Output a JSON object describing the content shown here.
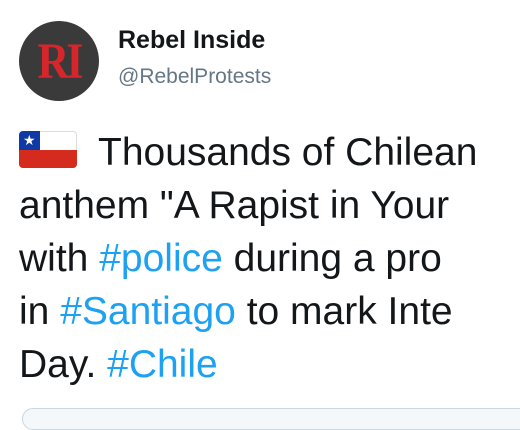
{
  "tweet": {
    "author": {
      "avatar_text": "RI",
      "display_name": "Rebel Inside",
      "handle": "@RebelProtests"
    },
    "flag_emoji": "chile-flag",
    "text_lines": [
      [
        "Thousands of Chilean"
      ],
      [
        "anthem \"A Rapist in Your"
      ],
      [
        "with ",
        "#police",
        " during a pro"
      ],
      [
        "in ",
        "#Santiago",
        " to mark Inte"
      ],
      [
        "Day. ",
        "#Chile",
        ""
      ]
    ],
    "hashtags": [
      "#police",
      "#Santiago",
      "#Chile"
    ]
  },
  "colors": {
    "text": "#14171a",
    "hashtag": "#1da1f2",
    "handle": "#657786",
    "avatar_bg": "#3a3a3a",
    "avatar_logo": "#d6262b"
  }
}
